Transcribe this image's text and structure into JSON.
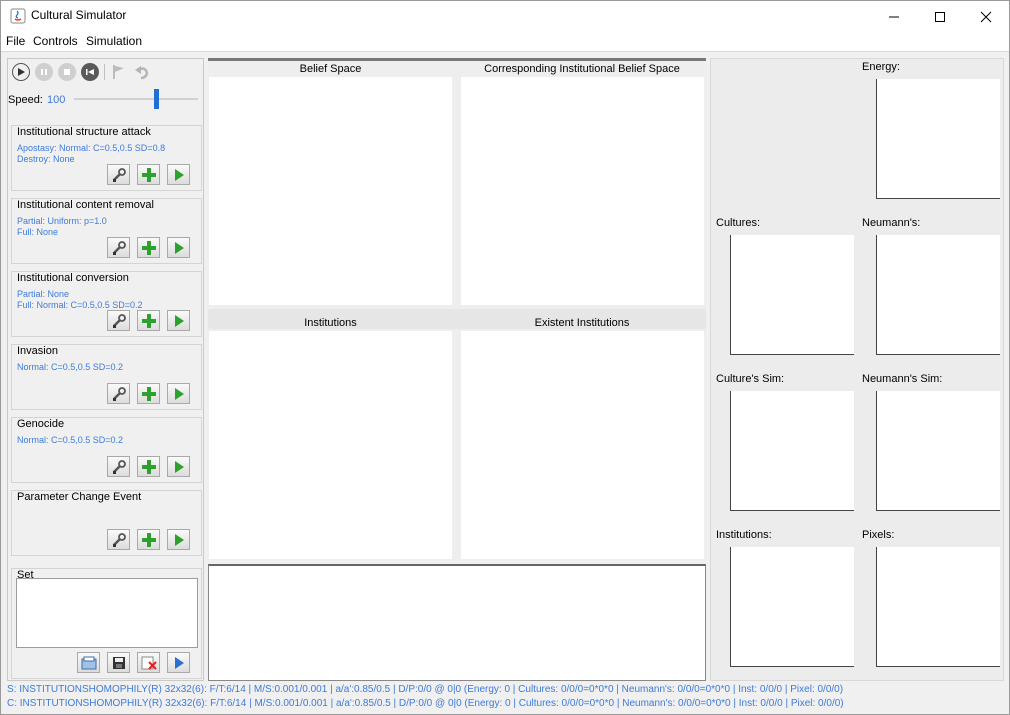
{
  "window": {
    "title": "Cultural Simulator",
    "minimize_icon": "minimize-icon",
    "maximize_icon": "maximize-icon",
    "close_icon": "close-icon"
  },
  "menu": [
    "File",
    "Controls",
    "Simulation"
  ],
  "toolbar": {
    "icons": [
      "play-icon",
      "pause-icon",
      "stop-icon",
      "rewind-icon",
      "flag-icon",
      "undo-icon"
    ],
    "speed_label": "Speed:",
    "speed_value": "100",
    "speed_fraction": 0.66
  },
  "events": [
    {
      "title": "Institutional structure attack",
      "lines": [
        "Apostasy: Normal: C=0.5,0.5 SD=0.8",
        "Destroy: None"
      ]
    },
    {
      "title": "Institutional content removal",
      "lines": [
        "Partial: Uniform: p=1.0",
        "Full: None"
      ]
    },
    {
      "title": "Institutional conversion",
      "lines": [
        "Partial: None",
        "Full: Normal: C=0.5,0.5 SD=0.2"
      ]
    },
    {
      "title": "Invasion",
      "lines": [
        "Normal: C=0.5,0.5 SD=0.2"
      ]
    },
    {
      "title": "Genocide",
      "lines": [
        "Normal: C=0.5,0.5 SD=0.2"
      ]
    },
    {
      "title": "Parameter Change Event",
      "lines": []
    }
  ],
  "event_button_icons": [
    "wrench-icon",
    "plus-icon",
    "play-icon"
  ],
  "set": {
    "title": "Set",
    "button_icons": [
      "open-icon",
      "save-icon",
      "delete-icon",
      "play-icon"
    ]
  },
  "center": {
    "belief_space": "Belief Space",
    "corresponding": "Corresponding Institutional Belief Space",
    "institutions": "Institutions",
    "existent": "Existent Institutions"
  },
  "right": {
    "energy": "Energy:",
    "cultures": "Cultures:",
    "neumanns": "Neumann's:",
    "cultures_sim": "Culture's Sim:",
    "neumanns_sim": "Neumann's Sim:",
    "institutions": "Institutions:",
    "pixels": "Pixels:"
  },
  "status": [
    "S: INSTITUTIONSHOMOPHILY(R) 32x32(6): F/T:6/14 | M/S:0.001/0.001 | a/a':0.85/0.5 | D/P:0/0 @ 0|0 (Energy: 0 | Cultures: 0/0/0=0*0*0 | Neumann's: 0/0/0=0*0*0 | Inst: 0/0/0 | Pixel: 0/0/0)",
    "C: INSTITUTIONSHOMOPHILY(R) 32x32(6): F/T:6/14 | M/S:0.001/0.001 | a/a':0.85/0.5 | D/P:0/0 @ 0|0 (Energy: 0 | Cultures: 0/0/0=0*0*0 | Neumann's: 0/0/0=0*0*0 | Inst: 0/0/0 | Pixel: 0/0/0)"
  ],
  "colors": {
    "accent": "#3e7bd8",
    "plus": "#2ea02e",
    "play": "#2ea02e"
  }
}
